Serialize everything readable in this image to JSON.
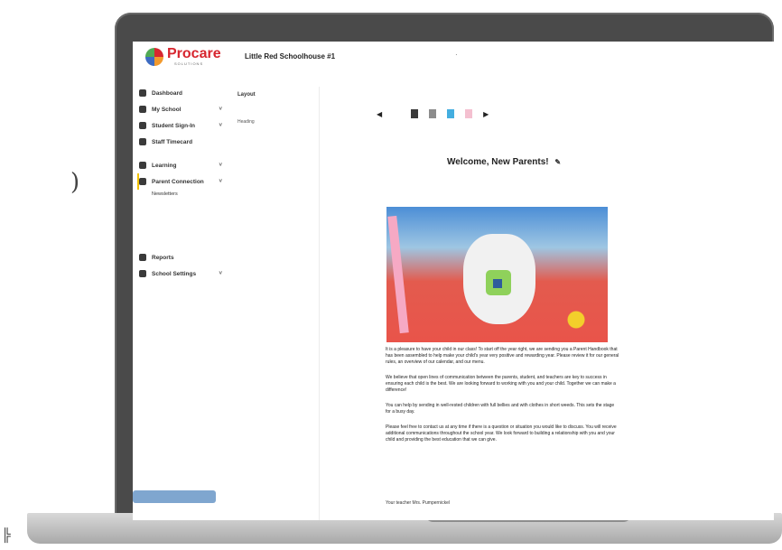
{
  "school": {
    "name": "Little Red Schoolhouse #1"
  },
  "header": {
    "note": "·"
  },
  "logo": {
    "word": "Procare",
    "sub": "SOLUTIONS"
  },
  "sidebar": {
    "items": [
      {
        "label": "Dashboard",
        "icon": "dashboard-icon",
        "chevron": ""
      },
      {
        "label": "My School",
        "icon": "school-icon",
        "chevron": "˅"
      },
      {
        "label": "Student Sign-In",
        "icon": "signin-icon",
        "chevron": "˅"
      },
      {
        "label": "Staff Timecard",
        "icon": "timecard-icon",
        "chevron": ""
      },
      {
        "label": "Learning",
        "icon": "learning-icon",
        "chevron": "˅"
      },
      {
        "label": "Parent Connection",
        "icon": "parents-icon",
        "chevron": "˅"
      }
    ],
    "sub_item": "Newsletters",
    "bottom_items": [
      {
        "label": "Reports",
        "icon": "reports-icon",
        "chevron": ""
      },
      {
        "label": "School Settings",
        "icon": "settings-icon",
        "chevron": "˅"
      }
    ]
  },
  "panel": {
    "title": "Layout",
    "item": "Heading"
  },
  "carousel": {
    "prev": "◀",
    "next": "▶",
    "thumb_colors": [
      "#ffffff",
      "#3a3a3a",
      "#8c8c8c",
      "#44aee0",
      "#f4c0d0"
    ]
  },
  "welcome": {
    "title": "Welcome, New Parents!",
    "edit_icon": "pencil-icon"
  },
  "article": {
    "paragraphs": [
      "It is a pleasure to have your child in our class! To start off the year right, we are sending you a Parent Handbook that has been assembled to help make your child's year very positive and rewarding year. Please review it for our general rules, an overview of our calendar, and our menu.",
      "We believe that open lines of communication between the parents, student, and teachers are key to success in ensuring each child is the best. We are looking forward to working with you and your child. Together we can make a difference!",
      "You can help by sending in well-rested children with full bellies and with clothes in short weeds. This sets the stage for a busy day.",
      "Please feel free to contact us at any time if there is a question or situation you would like to discuss. You will receive additional communications throughout the school year. We look forward to building a relationship with you and your child and providing the best education that we can give."
    ],
    "signoff": "Your teacher Mrs. Pumpernickel"
  },
  "colors": {
    "brand": "#d7262f",
    "accent": "#f2c200",
    "bezel": "#4a4a4a"
  }
}
